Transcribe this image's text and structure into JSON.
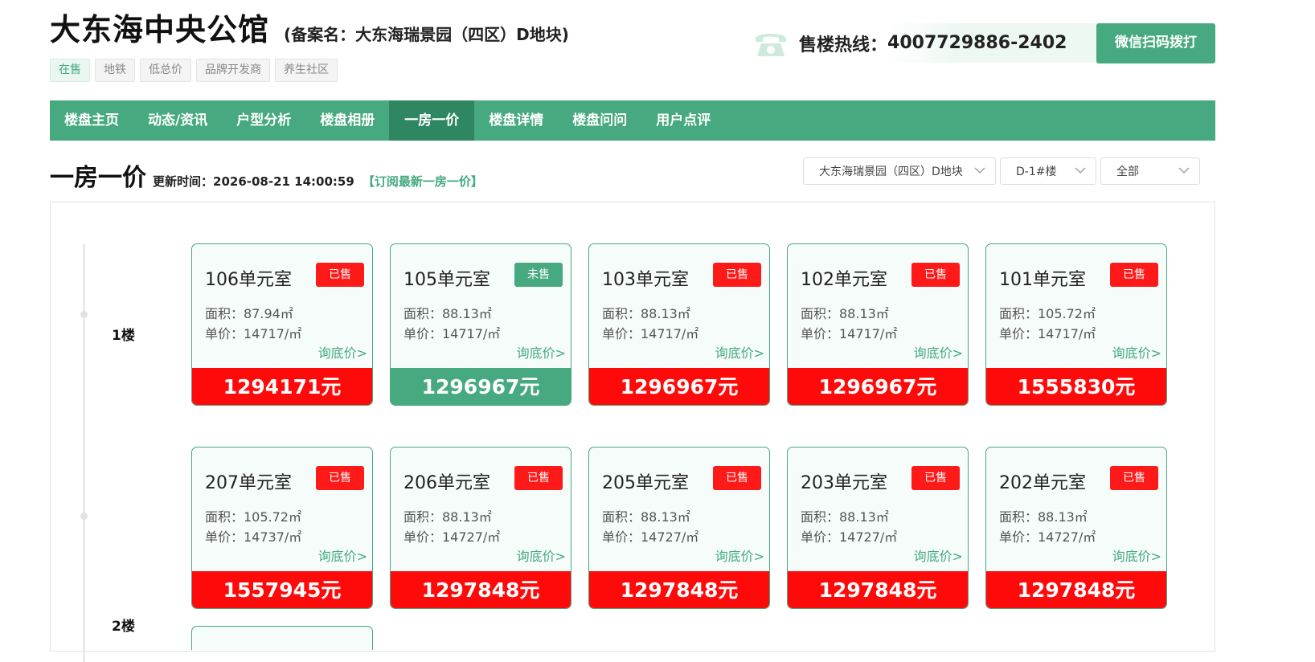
{
  "header": {
    "title": "大东海中央公馆",
    "record_name": "(备案名：大东海瑞景园（四区）D地块)",
    "hotline_label": "售楼热线：",
    "hotline_number": "4007729886-2402",
    "wechat_button": "微信扫码拨打",
    "tags": [
      "在售",
      "地铁",
      "低总价",
      "品牌开发商",
      "养生社区"
    ]
  },
  "nav": {
    "items": [
      "楼盘主页",
      "动态/资讯",
      "户型分析",
      "楼盘相册",
      "一房一价",
      "楼盘详情",
      "楼盘问问",
      "用户点评"
    ],
    "active": "一房一价"
  },
  "section": {
    "title": "一房一价",
    "update_label": "更新时间：",
    "update_time": "2026-08-21 14:00:59",
    "subscribe": "【订阅最新一房一价】"
  },
  "filters": {
    "project": "大东海瑞景园（四区）D地块",
    "building": "D-1#楼",
    "status": "全部"
  },
  "floors": [
    {
      "label": "1楼",
      "units": [
        {
          "room": "106单元室",
          "status": "已售",
          "area": "面积：87.94㎡",
          "price": "单价：14717/㎡",
          "ask": "询底价>",
          "total": "1294171元"
        },
        {
          "room": "105单元室",
          "status": "未售",
          "area": "面积：88.13㎡",
          "price": "单价：14717/㎡",
          "ask": "询底价>",
          "total": "1296967元"
        },
        {
          "room": "103单元室",
          "status": "已售",
          "area": "面积：88.13㎡",
          "price": "单价：14717/㎡",
          "ask": "询底价>",
          "total": "1296967元"
        },
        {
          "room": "102单元室",
          "status": "已售",
          "area": "面积：88.13㎡",
          "price": "单价：14717/㎡",
          "ask": "询底价>",
          "total": "1296967元"
        },
        {
          "room": "101单元室",
          "status": "已售",
          "area": "面积：105.72㎡",
          "price": "单价：14717/㎡",
          "ask": "询底价>",
          "total": "1555830元"
        }
      ]
    },
    {
      "label": "2楼",
      "units": [
        {
          "room": "207单元室",
          "status": "已售",
          "area": "面积：105.72㎡",
          "price": "单价：14737/㎡",
          "ask": "询底价>",
          "total": "1557945元"
        },
        {
          "room": "206单元室",
          "status": "已售",
          "area": "面积：88.13㎡",
          "price": "单价：14727/㎡",
          "ask": "询底价>",
          "total": "1297848元"
        },
        {
          "room": "205单元室",
          "status": "已售",
          "area": "面积：88.13㎡",
          "price": "单价：14727/㎡",
          "ask": "询底价>",
          "total": "1297848元"
        },
        {
          "room": "203单元室",
          "status": "已售",
          "area": "面积：88.13㎡",
          "price": "单价：14727/㎡",
          "ask": "询底价>",
          "total": "1297848元"
        },
        {
          "room": "202单元室",
          "status": "已售",
          "area": "面积：88.13㎡",
          "price": "单价：14727/㎡",
          "ask": "询底价>",
          "total": "1297848元"
        }
      ]
    }
  ],
  "colors": {
    "brand": "#46a97f",
    "brand_dark": "#2e8762",
    "sold": "#ff0a0a"
  }
}
